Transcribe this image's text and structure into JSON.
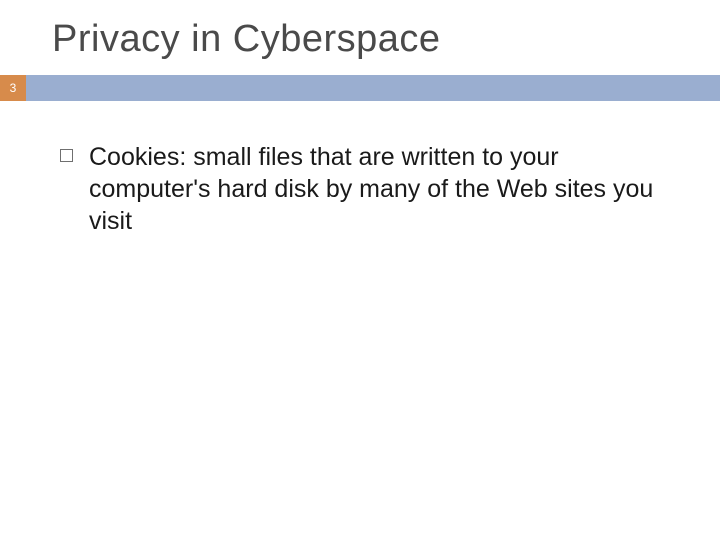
{
  "slide": {
    "title": "Privacy in Cyberspace",
    "pageNumber": "3",
    "bullets": [
      "Cookies: small files that are written to your computer's hard disk by many of the Web sites you visit"
    ]
  },
  "colors": {
    "accentOrange": "#d78b4b",
    "accentBlue": "#9aaed0"
  }
}
